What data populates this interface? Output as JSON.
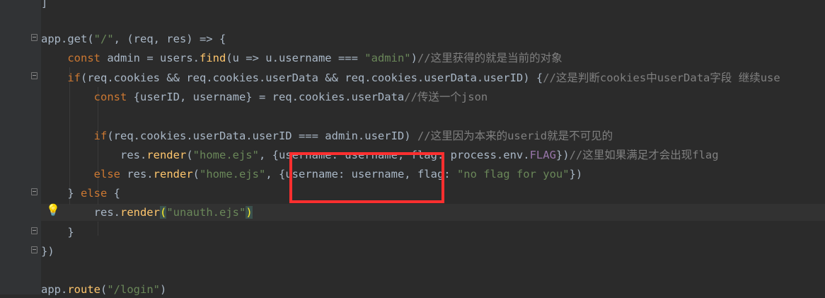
{
  "editor": {
    "lines": [
      "]",
      "",
      "app.get(\"/\", (req, res) => {",
      "    const admin = users.find(u => u.username === \"admin\")//这里获得的就是当前的对象",
      "    if(req.cookies && req.cookies.userData && req.cookies.userData.userID) {//这是判断cookies中userData字段 继续use",
      "        const {userID, username} = req.cookies.userData//传送一个json",
      "",
      "        if(req.cookies.userData.userID === admin.userID) //这里因为本来的userid就是不可见的",
      "            res.render(\"home.ejs\", {username: username, flag: process.env.FLAG})//这里如果满足才会出现flag",
      "        else res.render(\"home.ejs\", {username: username, flag: \"no flag for you\"})",
      "    } else {",
      "        res.render(\"unauth.ejs\")",
      "    }",
      "})",
      "",
      "app.route(\"/login\")"
    ],
    "line_numbers": [
      "",
      "",
      "",
      "",
      "",
      "",
      "",
      "",
      "",
      "",
      "",
      "",
      "",
      "",
      "",
      ""
    ],
    "colors": {
      "background": "#2b2b2b",
      "keyword": "#cc7832",
      "string": "#6a8759",
      "comment": "#808080",
      "highlight_box": "#ff2f2f"
    }
  }
}
